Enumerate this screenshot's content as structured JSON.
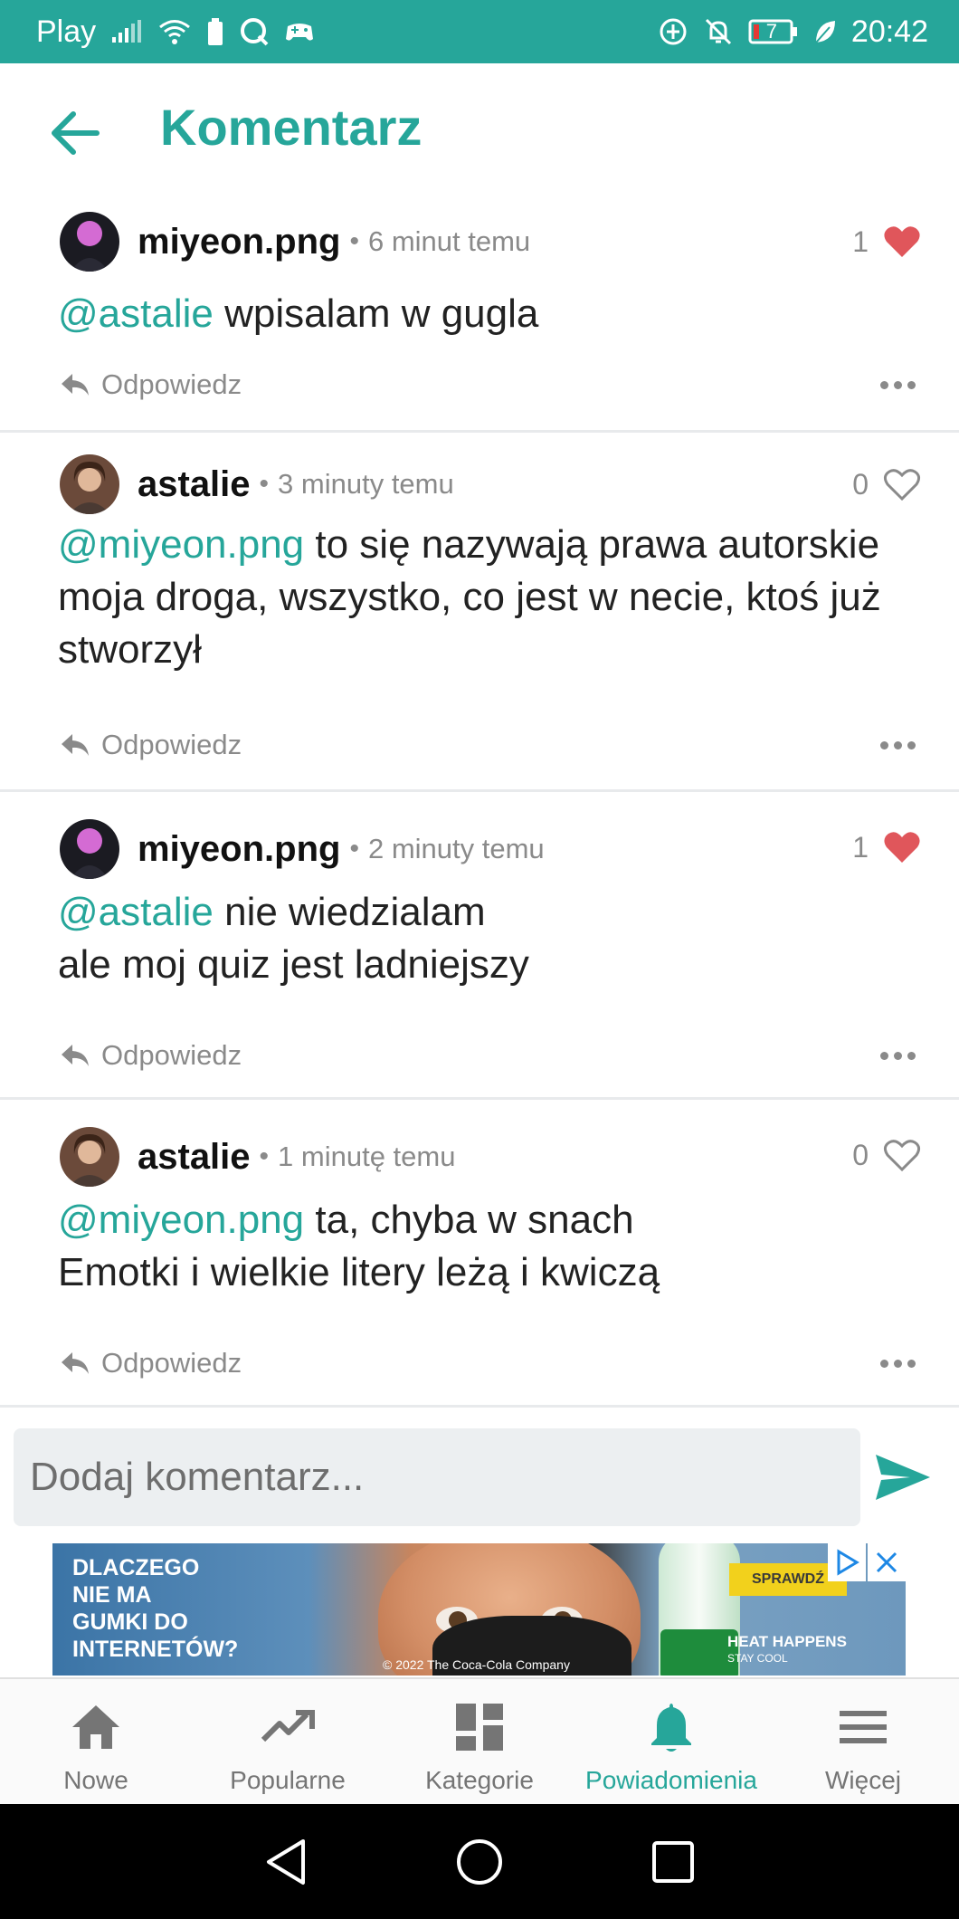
{
  "status_bar": {
    "carrier": "Play",
    "battery_level": "7",
    "time": "20:42",
    "icons": [
      "signal-icon",
      "wifi-icon",
      "battery-saver-icon",
      "q-app-icon",
      "game-icon",
      "data-saver-icon",
      "mute-bell-icon",
      "battery-icon",
      "leaf-icon"
    ]
  },
  "header": {
    "title": "Komentarz",
    "back_icon": "arrow-left-icon"
  },
  "comments": [
    {
      "user": "miyeon.png",
      "time": "6 minut temu",
      "likes": "1",
      "liked": true,
      "mention": "@astalie",
      "lines": [
        "wpisalam w gugla"
      ],
      "reply_label": "Odpowiedz"
    },
    {
      "user": "astalie",
      "time": "3 minuty temu",
      "likes": "0",
      "liked": false,
      "mention": "@miyeon.png",
      "lines": [
        "to się nazywają prawa autorskie moja droga, wszystko, co jest w necie, ktoś już stworzył"
      ],
      "reply_label": "Odpowiedz"
    },
    {
      "user": "miyeon.png",
      "time": "2 minuty temu",
      "likes": "1",
      "liked": true,
      "mention": "@astalie",
      "lines": [
        "nie wiedzialam",
        "ale moj quiz jest ladniejszy"
      ],
      "reply_label": "Odpowiedz"
    },
    {
      "user": "astalie",
      "time": "1 minutę temu",
      "likes": "0",
      "liked": false,
      "mention": "@miyeon.png",
      "lines": [
        "ta, chyba w snach",
        "Emotki i wielkie litery leżą i kwiczą"
      ],
      "reply_label": "Odpowiedz"
    }
  ],
  "composer": {
    "placeholder": "Dodaj komentarz..."
  },
  "ad": {
    "headline": [
      "DLACZEGO",
      "NIE MA",
      "GUMKI DO",
      "INTERNETÓW?"
    ],
    "cta": "SPRAWDŹ",
    "slogan": [
      "HEAT HAPPENS",
      "STAY COOL"
    ],
    "copyright": "© 2022 The Coca-Cola Company"
  },
  "bottom_nav": [
    {
      "label": "Nowe",
      "icon": "home-icon",
      "active": false
    },
    {
      "label": "Popularne",
      "icon": "trending-icon",
      "active": false
    },
    {
      "label": "Kategorie",
      "icon": "dashboard-icon",
      "active": false
    },
    {
      "label": "Powiadomienia",
      "icon": "bell-icon",
      "active": true
    },
    {
      "label": "Więcej",
      "icon": "menu-icon",
      "active": false
    }
  ],
  "colors": {
    "accent": "#26a69a",
    "like_red": "#e0565b",
    "muted": "#8a8a8a"
  }
}
